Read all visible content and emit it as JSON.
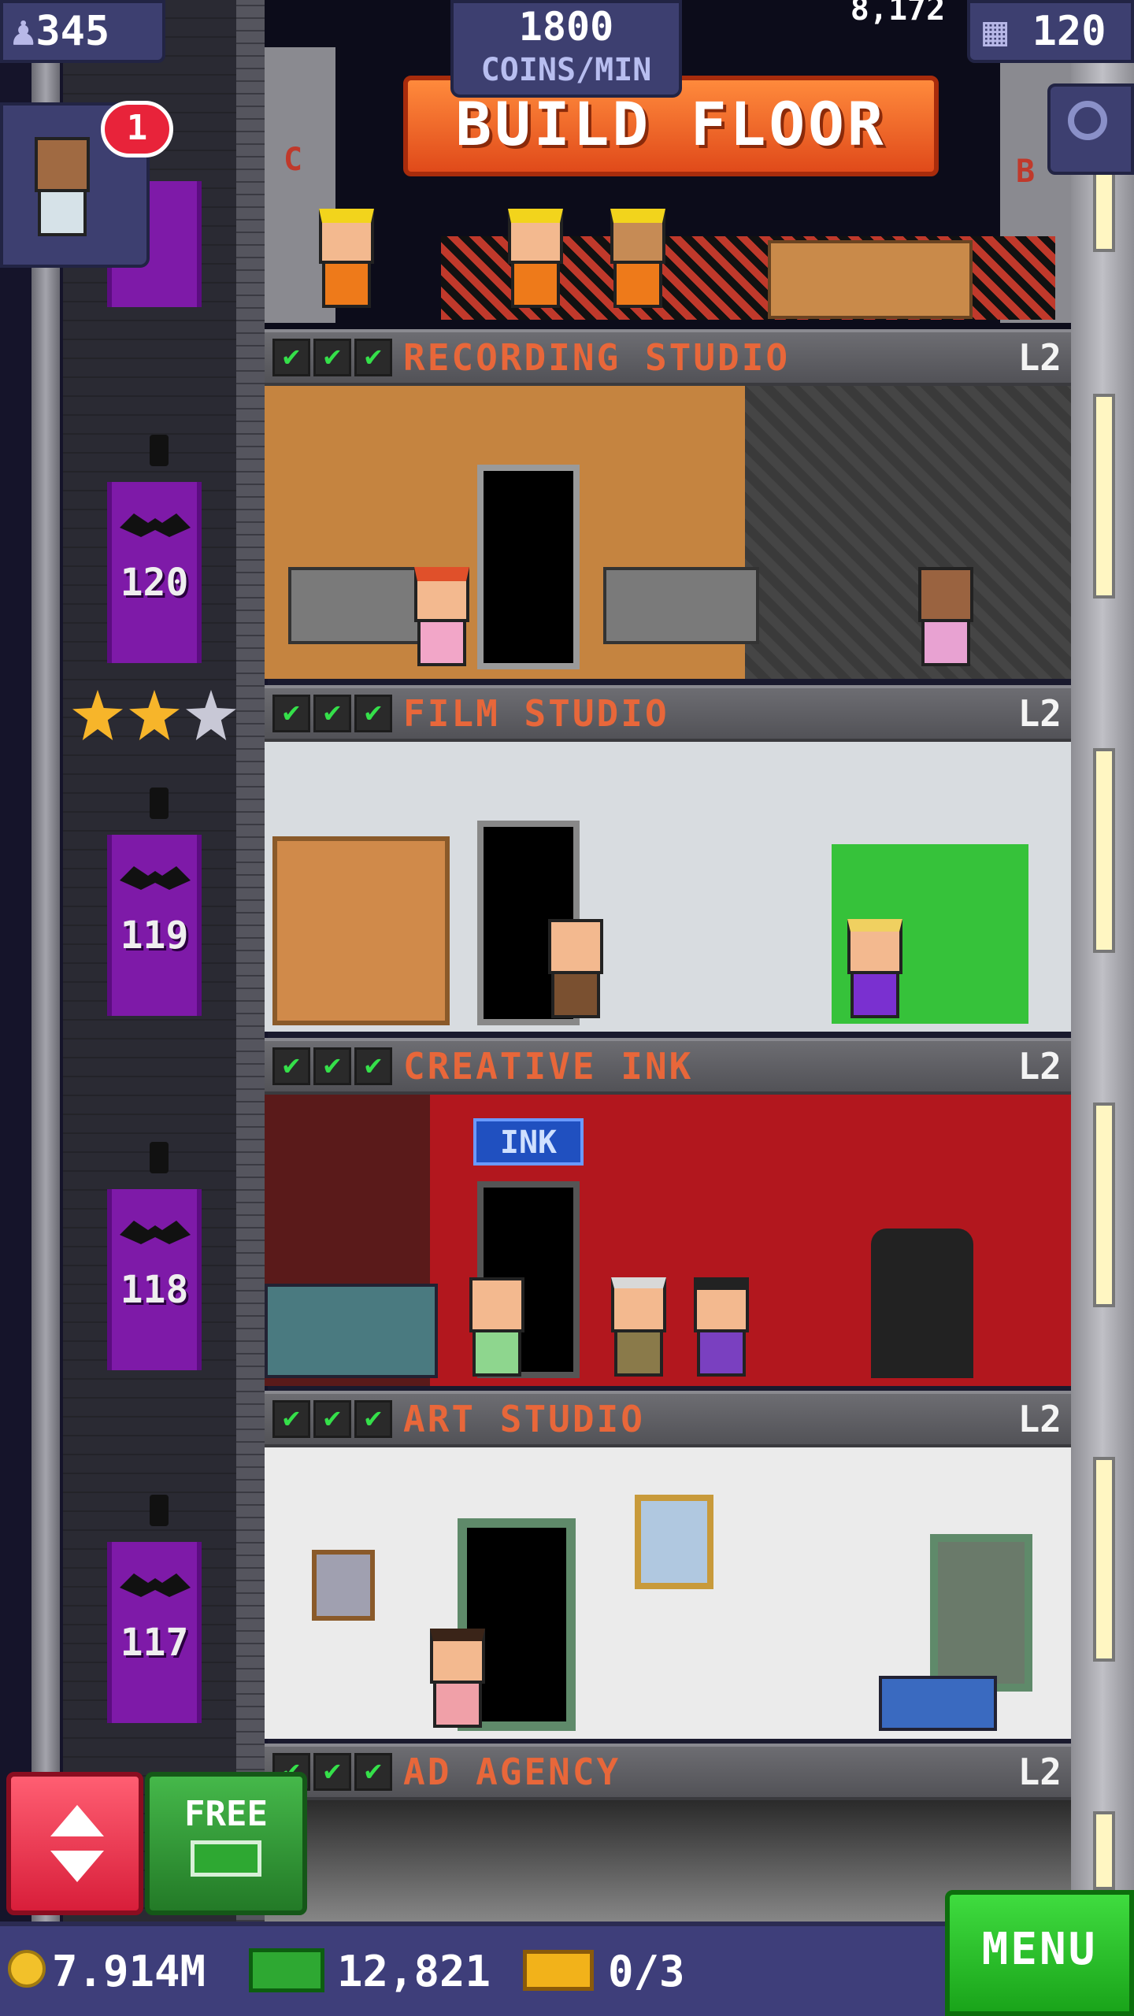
{
  "hud": {
    "population": "345",
    "coins_per_min_value": "1800",
    "coins_per_min_label": "COINS/MIN",
    "floor_count_partial": "8,172",
    "bux_floors": "120",
    "notification_badge": "1"
  },
  "build_floor_label": "BUILD FLOOR",
  "floor_signs": {
    "left": "C",
    "right": "B"
  },
  "floors": [
    {
      "name": "RECORDING STUDIO",
      "level": "L2",
      "elevator_floor": "120"
    },
    {
      "name": "FILM STUDIO",
      "level": "L2",
      "elevator_floor": "119"
    },
    {
      "name": "CREATIVE INK",
      "level": "L2",
      "elevator_floor": "118"
    },
    {
      "name": "ART STUDIO",
      "level": "L2",
      "elevator_floor": "117"
    },
    {
      "name": "AD AGENCY",
      "level": "L2"
    }
  ],
  "check_mark": "✔",
  "ink_sign": "INK",
  "stars": {
    "earned": 2,
    "total": 3
  },
  "bottom": {
    "coins": "7.914M",
    "bux": "12,821",
    "tickets": "0/3",
    "free_label": "FREE",
    "menu_label": "MENU"
  },
  "colors": {
    "accent_orange": "#e8673a",
    "elevator_purple": "#7e1aa8",
    "menu_green": "#28b828",
    "elevator_button_red": "#e8334a"
  },
  "icons": [
    "person-icon",
    "building-icon",
    "magnifier-icon",
    "up-down-arrows-icon",
    "coin-icon",
    "bux-icon",
    "ticket-icon",
    "star-icon",
    "bat-icon"
  ]
}
